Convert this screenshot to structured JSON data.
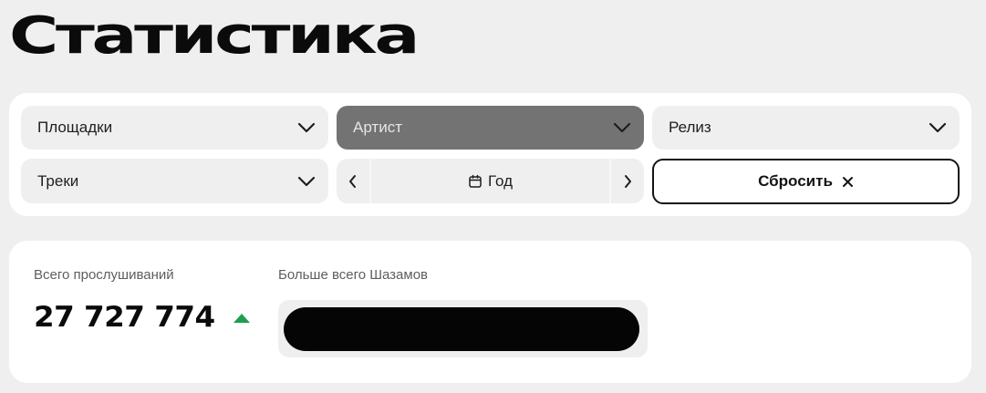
{
  "page": {
    "title": "Статистика"
  },
  "filters": {
    "platforms": "Площадки",
    "artist": "Артист",
    "release": "Релиз",
    "tracks": "Треки",
    "period": {
      "label": "Год"
    },
    "reset_label": "Сбросить"
  },
  "stats": {
    "total_label": "Всего прослушиваний",
    "total_value": "27 727 774",
    "trend": "up",
    "trend_color": "#1f9e4f",
    "top_shazam_label": "Больше всего Шазамов"
  },
  "colors": {
    "background": "#efefef",
    "card": "#ffffff",
    "active_select": "#737373"
  }
}
